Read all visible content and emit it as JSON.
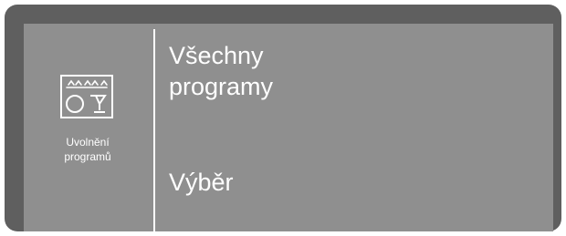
{
  "left_panel": {
    "icon": "dishwasher-icon",
    "label_line1": "Uvolnění",
    "label_line2": "programů"
  },
  "menu": {
    "items": [
      {
        "line1": "Všechny",
        "line2": "programy"
      },
      {
        "line1": "Výběr"
      }
    ]
  },
  "colors": {
    "frame": "#5f5f5f",
    "screen": "#8f8f8f",
    "text": "#ffffff"
  }
}
